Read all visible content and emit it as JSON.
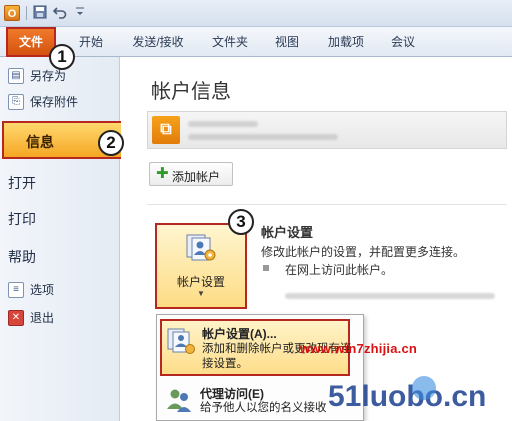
{
  "quick_access": {
    "app_icon_label": "O",
    "save_icon": "save-icon",
    "undo_icon": "undo-icon",
    "customize_icon": "customize-icon"
  },
  "ribbon": {
    "tabs": [
      {
        "label": "文件"
      },
      {
        "label": "开始"
      },
      {
        "label": "发送/接收"
      },
      {
        "label": "文件夹"
      },
      {
        "label": "视图"
      },
      {
        "label": "加载项"
      },
      {
        "label": "会议"
      }
    ]
  },
  "leftpane": {
    "items": [
      {
        "label": "另存为"
      },
      {
        "label": "保存附件"
      },
      {
        "label": "信息"
      },
      {
        "label": "打开"
      },
      {
        "label": "打印"
      },
      {
        "label": "帮助"
      },
      {
        "label": "选项"
      },
      {
        "label": "退出"
      }
    ]
  },
  "main": {
    "title": "帐户信息",
    "add_account_label": "添加帐户",
    "account_settings_button": "帐户设置",
    "section_heading": "帐户设置",
    "section_desc": "修改此帐户的设置，并配置更多连接。",
    "bullet_text": "在网上访问此帐户。"
  },
  "dropdown": {
    "item1_title": "帐户设置(A)...",
    "item1_desc": "添加和删除帐户或更改现有连接设置。",
    "item2_title": "代理访问(E)",
    "item2_desc": "给予他人以您的名义接收"
  },
  "steps": [
    "1",
    "2",
    "3"
  ],
  "watermark": {
    "url": "www.win7zhijia.cn",
    "logo_text": "51luobo.cn"
  },
  "colors": {
    "highlight_border": "#b5271f",
    "file_tab": "#e2651a",
    "selection": "#fbc650"
  }
}
